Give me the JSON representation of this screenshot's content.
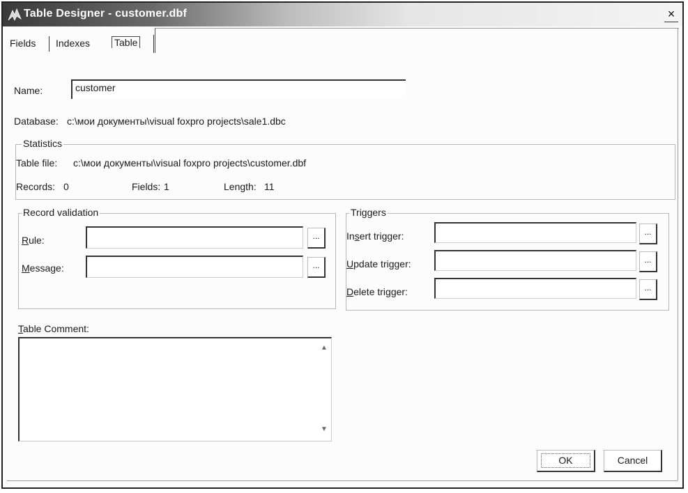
{
  "window": {
    "title": "Table Designer - customer.dbf",
    "close_glyph": "×|"
  },
  "tabs": [
    {
      "label": "Fields",
      "active": false
    },
    {
      "label": "Indexes",
      "active": false
    },
    {
      "label": "Table",
      "active": true
    }
  ],
  "name": {
    "label": "Name:",
    "value": "customer"
  },
  "database": {
    "label": "Database:",
    "value": "c:\\мои документы\\visual foxpro projects\\sale1.dbc"
  },
  "statistics": {
    "title": "Statistics",
    "table_file_label": "Table file:",
    "table_file_value": "c:\\мои документы\\visual foxpro projects\\customer.dbf",
    "records_label": "Records:",
    "records_value": "0",
    "fields_label": "Fields:",
    "fields_value": "1",
    "length_label": "Length:",
    "length_value": "11"
  },
  "record_validation": {
    "title": "Record validation",
    "rule_label": "Rule:",
    "rule_value": "",
    "message_label": "Message:",
    "message_value": "",
    "browse_label": "..."
  },
  "triggers": {
    "title": "Triggers",
    "insert_label": "Insert trigger:",
    "update_label": "Update trigger:",
    "delete_label": "Delete trigger:",
    "insert_value": "",
    "update_value": "",
    "delete_value": "",
    "browse_label": "..."
  },
  "comment": {
    "label": "Table Comment:",
    "value": ""
  },
  "buttons": {
    "ok": "OK",
    "cancel": "Cancel"
  },
  "icons": {
    "app": "foxpro-icon",
    "close": "close-icon"
  }
}
